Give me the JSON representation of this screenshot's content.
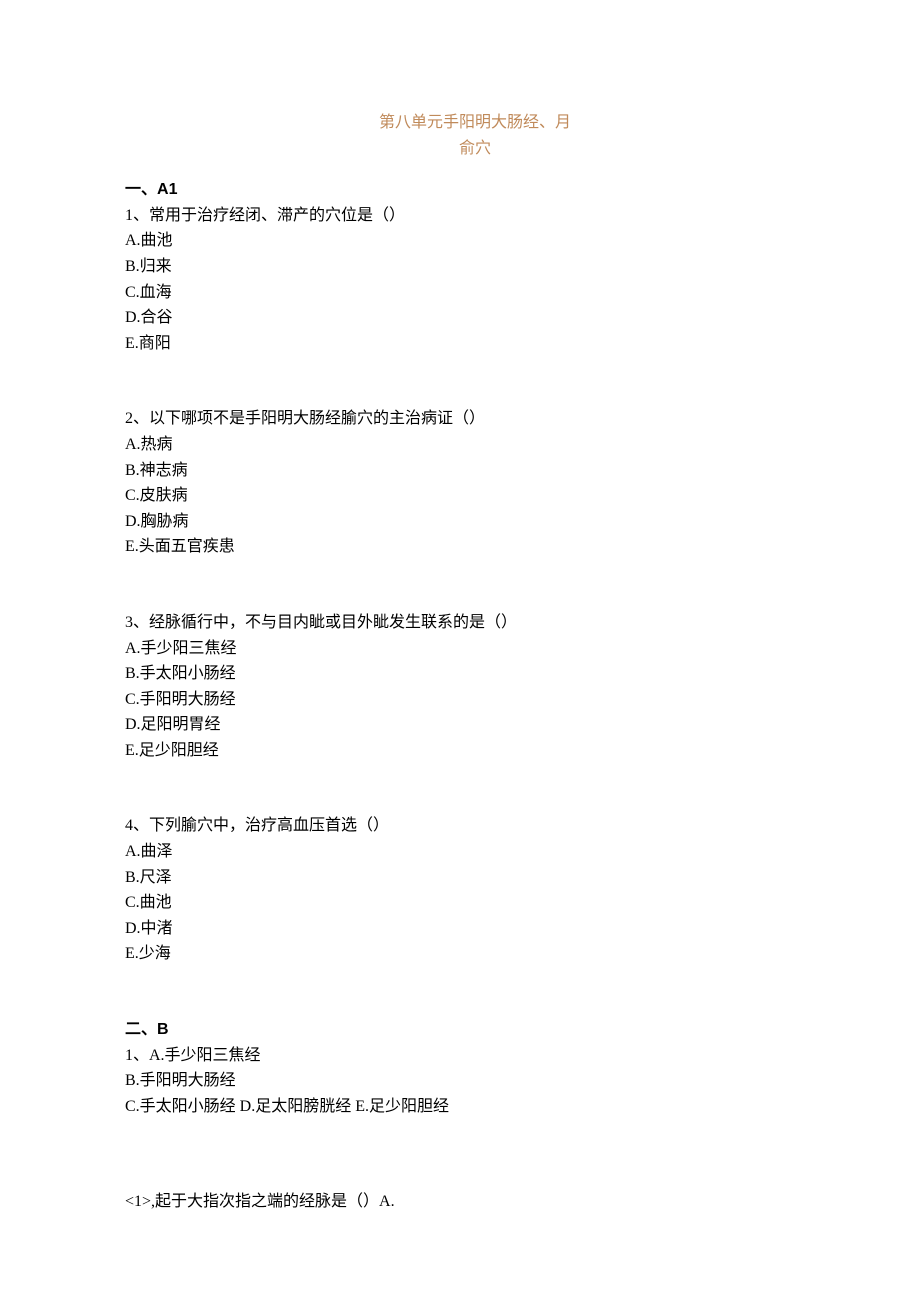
{
  "title": "第八单元手阳明大肠经、月俞穴",
  "sectionA": {
    "heading_prefix": "一、",
    "heading_label": "A1",
    "q1": {
      "stem": "1、常用于治疗经闭、滞产的穴位是（）",
      "A": "A.曲池",
      "B": "B.归来",
      "C": "C.血海",
      "D": "D.合谷",
      "E": "E.商阳"
    },
    "q2": {
      "stem": "2、以下哪项不是手阳明大肠经腧穴的主治病证（）",
      "A": "A.热病",
      "B": "B.神志病",
      "C": "C.皮肤病",
      "D": "D.胸胁病",
      "E": "E.头面五官疾患"
    },
    "q3": {
      "stem": "3、经脉循行中，不与目内眦或目外眦发生联系的是（）",
      "A": "A.手少阳三焦经",
      "B": "B.手太阳小肠经",
      "C": "C.手阳明大肠经",
      "D": "D.足阳明胃经",
      "E": "E.足少阳胆经"
    },
    "q4": {
      "stem": "4、下列腧穴中，治疗高血压首选（）",
      "A": "A.曲泽",
      "B": "B.尺泽",
      "C": "C.曲池",
      "D": "D.中渚",
      "E": "E.少海"
    }
  },
  "sectionB": {
    "heading_prefix": "二、",
    "heading_label": "B",
    "q1": {
      "line1": "1、A.手少阳三焦经",
      "line2": "B.手阳明大肠经",
      "line3": "C.手太阳小肠经 D.足太阳膀胱经 E.足少阳胆经"
    },
    "sub1": "<1>,起于大指次指之端的经脉是（）A."
  }
}
